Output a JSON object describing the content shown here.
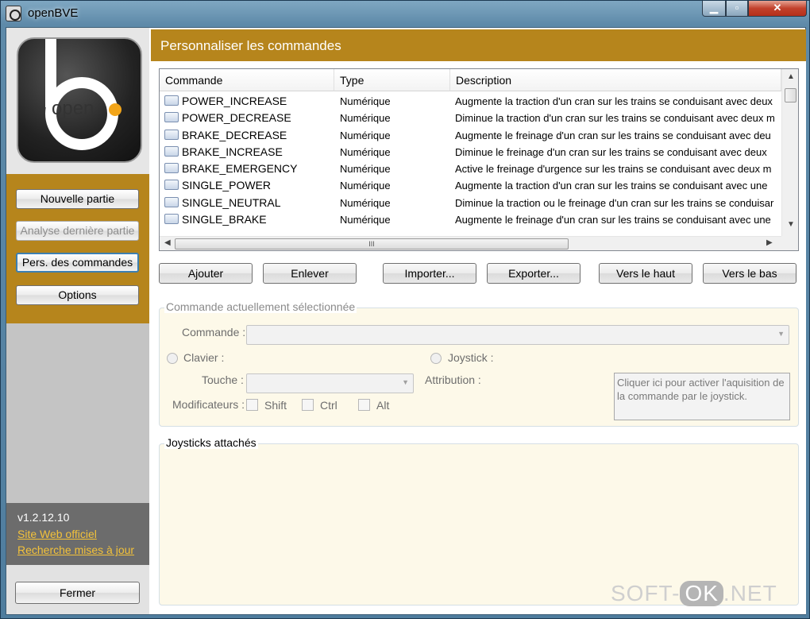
{
  "window": {
    "title": "openBVE",
    "min_glyph": "▁",
    "max_glyph": "▫",
    "close_glyph": "✕"
  },
  "logo": {
    "word": "open"
  },
  "sidebar": {
    "nav": [
      {
        "label": "Nouvelle partie"
      },
      {
        "label": "Analyse dernière partie"
      },
      {
        "label": "Pers. des commandes"
      },
      {
        "label": "Options"
      }
    ],
    "version": "v1.2.12.10",
    "link_site": "Site Web officiel",
    "link_updates": "Recherche mises à jour",
    "quit_label": "Fermer"
  },
  "header": {
    "title": "Personnaliser les commandes"
  },
  "grid": {
    "columns": [
      "Commande",
      "Type",
      "Description"
    ],
    "rows": [
      {
        "command": "POWER_INCREASE",
        "type": "Numérique",
        "description": "Augmente la traction d'un cran sur les trains se conduisant avec deux"
      },
      {
        "command": "POWER_DECREASE",
        "type": "Numérique",
        "description": "Diminue la traction d'un cran sur les trains se conduisant avec deux m"
      },
      {
        "command": "BRAKE_DECREASE",
        "type": "Numérique",
        "description": "Augmente le freinage d'un cran sur les trains se conduisant avec deu"
      },
      {
        "command": "BRAKE_INCREASE",
        "type": "Numérique",
        "description": "Diminue le freinage d'un cran sur les trains se conduisant avec deux"
      },
      {
        "command": "BRAKE_EMERGENCY",
        "type": "Numérique",
        "description": "Active le freinage d'urgence sur les trains se conduisant avec deux m"
      },
      {
        "command": "SINGLE_POWER",
        "type": "Numérique",
        "description": "Augmente la traction d'un cran sur les trains se conduisant avec une"
      },
      {
        "command": "SINGLE_NEUTRAL",
        "type": "Numérique",
        "description": "Diminue la traction ou le freinage d'un cran sur les trains se conduisar"
      },
      {
        "command": "SINGLE_BRAKE",
        "type": "Numérique",
        "description": "Augmente le freinage d'un cran sur les trains se conduisant avec une"
      }
    ],
    "hscroll_grip": "III"
  },
  "actions": {
    "add": "Ajouter",
    "remove": "Enlever",
    "import": "Importer...",
    "export": "Exporter...",
    "up": "Vers le haut",
    "down": "Vers le bas"
  },
  "selected": {
    "group_title": "Commande actuellement sélectionnée",
    "command_label": "Commande :",
    "keyboard_label": "Clavier :",
    "joystick_label": "Joystick :",
    "key_label": "Touche :",
    "assignment_label": "Attribution :",
    "modifiers_label": "Modificateurs :",
    "shift": "Shift",
    "ctrl": "Ctrl",
    "alt": "Alt",
    "joystick_hint": "Cliquer ici pour activer l'aquisition de la commande par le joystick."
  },
  "joysticks": {
    "group_title": "Joysticks attachés"
  },
  "watermark": {
    "left": "SOFT-",
    "ok": "OK",
    "right": ".NET"
  }
}
